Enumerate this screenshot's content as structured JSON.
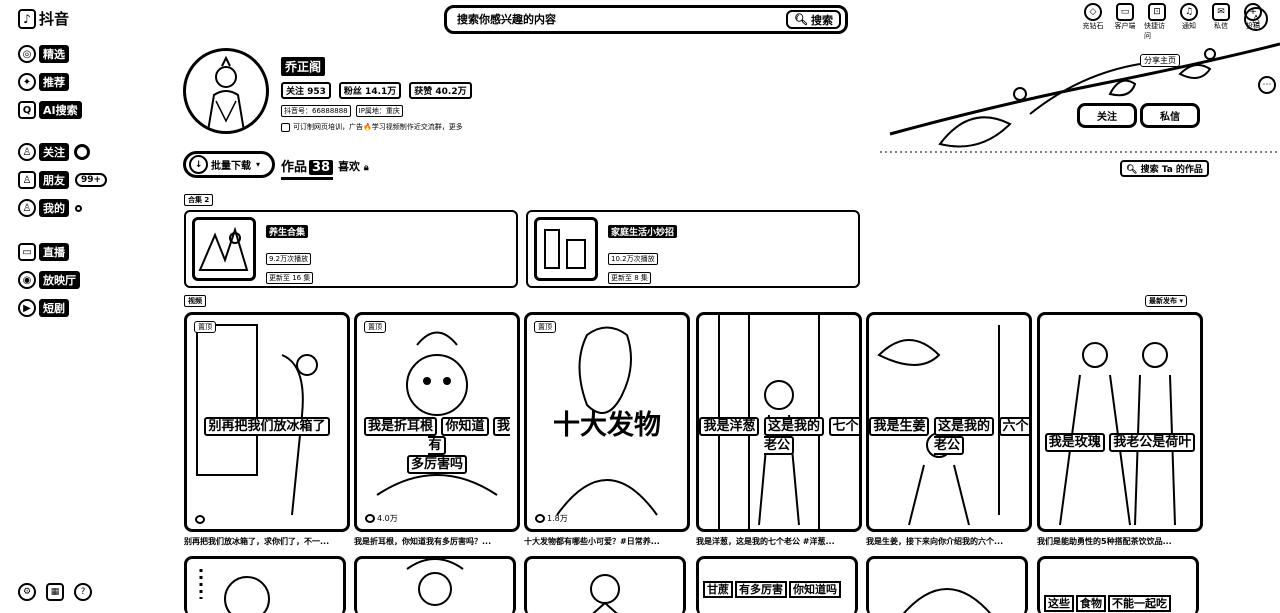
{
  "app": {
    "name": "抖音"
  },
  "sidebar": {
    "items": [
      {
        "label": "精选",
        "icon": "featured-icon"
      },
      {
        "label": "推荐",
        "icon": "recommend-icon"
      },
      {
        "label": "AI搜索",
        "icon": "ai-search-icon"
      },
      {
        "label": "关注",
        "icon": "follow-icon"
      },
      {
        "label": "朋友",
        "icon": "friends-icon",
        "badge": "99+"
      },
      {
        "label": "我的",
        "icon": "mine-icon"
      },
      {
        "label": "直播",
        "icon": "live-icon"
      },
      {
        "label": "放映厅",
        "icon": "cinema-icon"
      },
      {
        "label": "短剧",
        "icon": "drama-icon"
      }
    ]
  },
  "search": {
    "placeholder": "搜索你感兴趣的内容",
    "button": "搜索"
  },
  "topbar": {
    "items": [
      {
        "label": "充钻石",
        "icon": "diamond-icon"
      },
      {
        "label": "客户端",
        "icon": "client-icon"
      },
      {
        "label": "快捷访问",
        "icon": "shortcut-icon"
      },
      {
        "label": "通知",
        "icon": "bell-icon"
      },
      {
        "label": "私信",
        "icon": "message-icon"
      },
      {
        "label": "投稿",
        "icon": "upload-icon"
      }
    ]
  },
  "profile": {
    "name": "乔正阁",
    "following": "关注 953",
    "followers": "粉丝 14.1万",
    "likes": "获赞 40.2万",
    "account_id": "抖音号：66888888",
    "ip": "IP属地：重庆",
    "bio": "可订制网页培训，广告🔥学习视频制作近交流群，更多"
  },
  "actions": {
    "share": "分享主页",
    "follow": "关注",
    "message": "私信"
  },
  "tabs": {
    "batch": "批量下载",
    "works_label": "作品",
    "works_count": "38",
    "likes_label": "喜欢",
    "search_works": "搜索 Ta 的作品"
  },
  "collections_section": {
    "label": "合集 2"
  },
  "collections": [
    {
      "title": "养生合集",
      "plays": "9.2万次播放",
      "updated": "更新至 16 集"
    },
    {
      "title": "家庭生活小妙招",
      "plays": "10.2万次播放",
      "updated": "更新至 8 集"
    }
  ],
  "videos_section": {
    "label": "视频",
    "sort": "最新发布"
  },
  "videos": [
    {
      "tag": "置顶",
      "overlay": [
        "别再把我们放冰箱了"
      ],
      "likes": "",
      "caption": "别再把我们放冰箱了，求你们了，不一..."
    },
    {
      "tag": "置顶",
      "overlay": [
        "我是折耳根",
        "你知道",
        "我有",
        "多厉害吗"
      ],
      "likes": "4.0万",
      "caption": "我是折耳根，你知道我有多厉害吗？..."
    },
    {
      "tag": "置顶",
      "overlay": [
        "十大发物"
      ],
      "likes": "1.8万",
      "caption": "十大发物都有哪些小可爱？#日常养..."
    },
    {
      "tag": "",
      "overlay": [
        "我是洋葱",
        "这是我的",
        "七个老公"
      ],
      "likes": "",
      "caption": "我是洋葱，这是我的七个老公 #洋葱..."
    },
    {
      "tag": "",
      "overlay": [
        "我是生姜",
        "这是我的",
        "六个老公"
      ],
      "likes": "",
      "caption": "我是生姜，接下来向你介绍我的六个..."
    },
    {
      "tag": "",
      "overlay": [
        "我是玫瑰",
        "我老公是荷叶"
      ],
      "likes": "",
      "caption": "我们是能助勇性的5种搭配茶饮饮品..."
    }
  ],
  "row2": [
    {
      "overlay": []
    },
    {
      "overlay": []
    },
    {
      "overlay": []
    },
    {
      "overlay": [
        "甘蔗",
        "有多厉害",
        "你知道吗"
      ]
    },
    {
      "overlay": []
    },
    {
      "overlay": [
        "这些",
        "食物",
        "不能一起吃"
      ]
    }
  ]
}
